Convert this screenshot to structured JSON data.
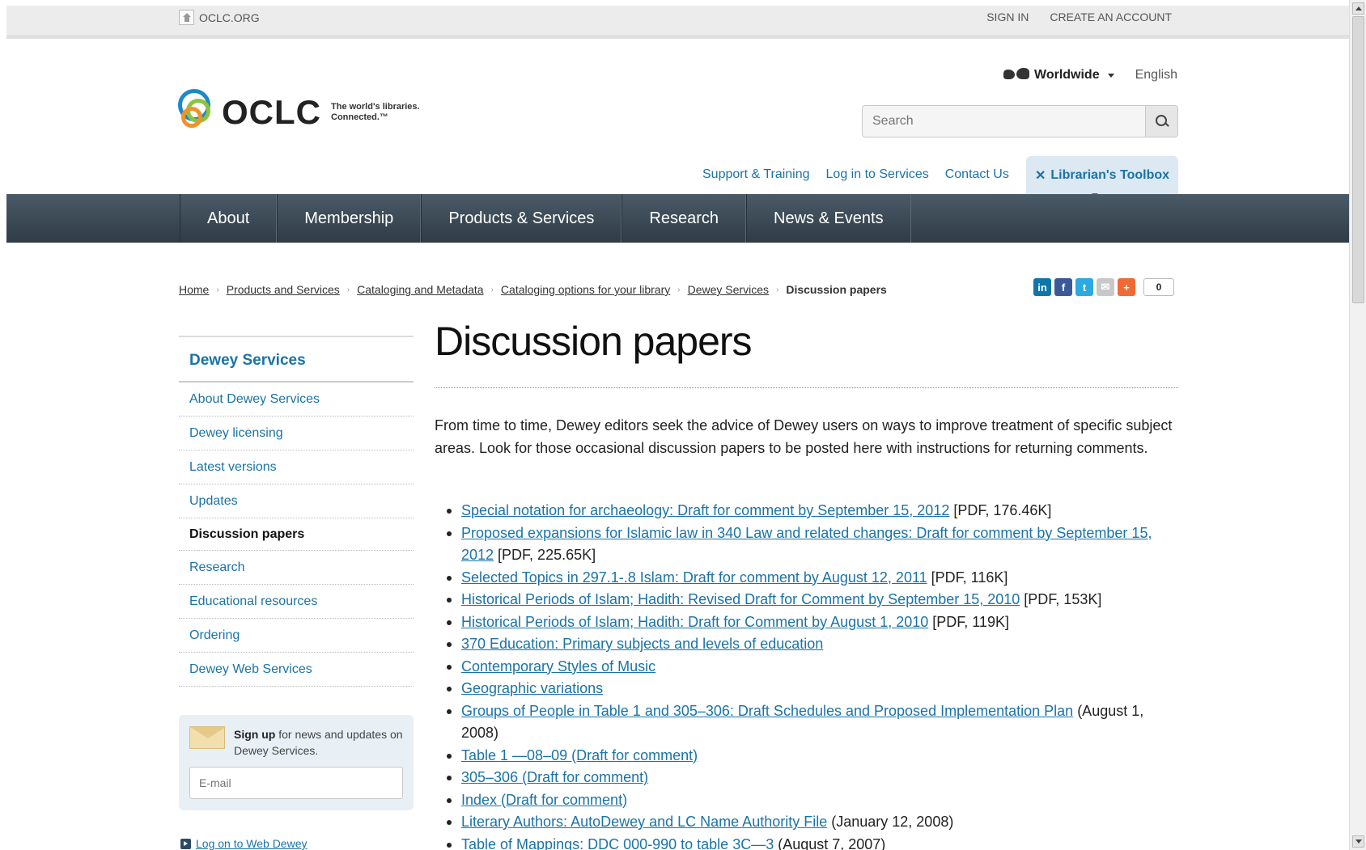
{
  "utility": {
    "site": "OCLC.ORG",
    "sign_in": "SIGN IN",
    "create_account": "CREATE AN ACCOUNT"
  },
  "header": {
    "logo_text": "OCLC",
    "tagline": "The world's libraries. Connected.™",
    "region": "Worldwide",
    "language": "English",
    "search_placeholder": "Search",
    "quicklinks": [
      "Support & Training",
      "Log in to Services",
      "Contact Us"
    ],
    "toolbox": "Librarian's Toolbox"
  },
  "nav": [
    "About",
    "Membership",
    "Products & Services",
    "Research",
    "News & Events"
  ],
  "breadcrumb": {
    "links": [
      "Home",
      "Products and Services",
      "Cataloging and Metadata",
      "Cataloging options for your library",
      "Dewey Services"
    ],
    "current": "Discussion papers"
  },
  "share": {
    "count": "0"
  },
  "sidebar": {
    "title": "Dewey Services",
    "items": [
      {
        "label": "About Dewey Services",
        "active": false
      },
      {
        "label": "Dewey licensing",
        "active": false
      },
      {
        "label": "Latest versions",
        "active": false
      },
      {
        "label": "Updates",
        "active": false
      },
      {
        "label": "Discussion papers",
        "active": true
      },
      {
        "label": "Research",
        "active": false
      },
      {
        "label": "Educational resources",
        "active": false
      },
      {
        "label": "Ordering",
        "active": false
      },
      {
        "label": "Dewey Web Services",
        "active": false
      }
    ],
    "signup_bold": "Sign up",
    "signup_rest": " for news and updates on Dewey Services.",
    "email_placeholder": "E-mail",
    "webdewey": "Log on to Web Dewey"
  },
  "main": {
    "title": "Discussion papers",
    "intro": "From time to time, Dewey editors seek the advice of Dewey users on ways to improve treatment of specific subject areas. Look for those occasional discussion papers to be posted here with instructions for returning comments.",
    "documents": [
      {
        "link": "Special notation for archaeology: Draft for comment by September 15, 2012",
        "note": " [PDF, 176.46K]"
      },
      {
        "link": "Proposed expansions for Islamic law in 340 Law and related changes: Draft for comment by September 15, 2012",
        "note": " [PDF, 225.65K]"
      },
      {
        "link": "Selected Topics in 297.1-.8 Islam: Draft for comment by August 12, 2011",
        "note": " [PDF, 116K]"
      },
      {
        "link": "Historical Periods of Islam; Hadith: Revised Draft for Comment by September 15, 2010",
        "note": " [PDF, 153K]"
      },
      {
        "link": "Historical Periods of Islam; Hadith: Draft for Comment by August 1, 2010",
        "note": " [PDF, 119K]"
      },
      {
        "link": "370 Education: Primary subjects and levels of education",
        "note": ""
      },
      {
        "link": "Contemporary Styles of Music",
        "note": ""
      },
      {
        "link": "Geographic variations",
        "note": ""
      },
      {
        "link": "Groups of People in Table 1 and 305–306: Draft Schedules and Proposed Implementation Plan",
        "note": " (August 1, 2008)"
      },
      {
        "link": "Table 1 —08–09 (Draft for comment)",
        "note": ""
      },
      {
        "link": "305–306 (Draft for comment)",
        "note": ""
      },
      {
        "link": "Index (Draft for comment)",
        "note": ""
      },
      {
        "link": "Literary Authors: AutoDewey and LC Name Authority File",
        "note": " (January 12, 2008)"
      },
      {
        "link": "Table of Mappings: DDC 000-990 to table 3C—3",
        "note": " (August 7, 2007)"
      }
    ]
  },
  "colors": {
    "link": "#1a73a7",
    "nav_bg": "#36434e",
    "toolbox_bg": "#dce8f2"
  }
}
